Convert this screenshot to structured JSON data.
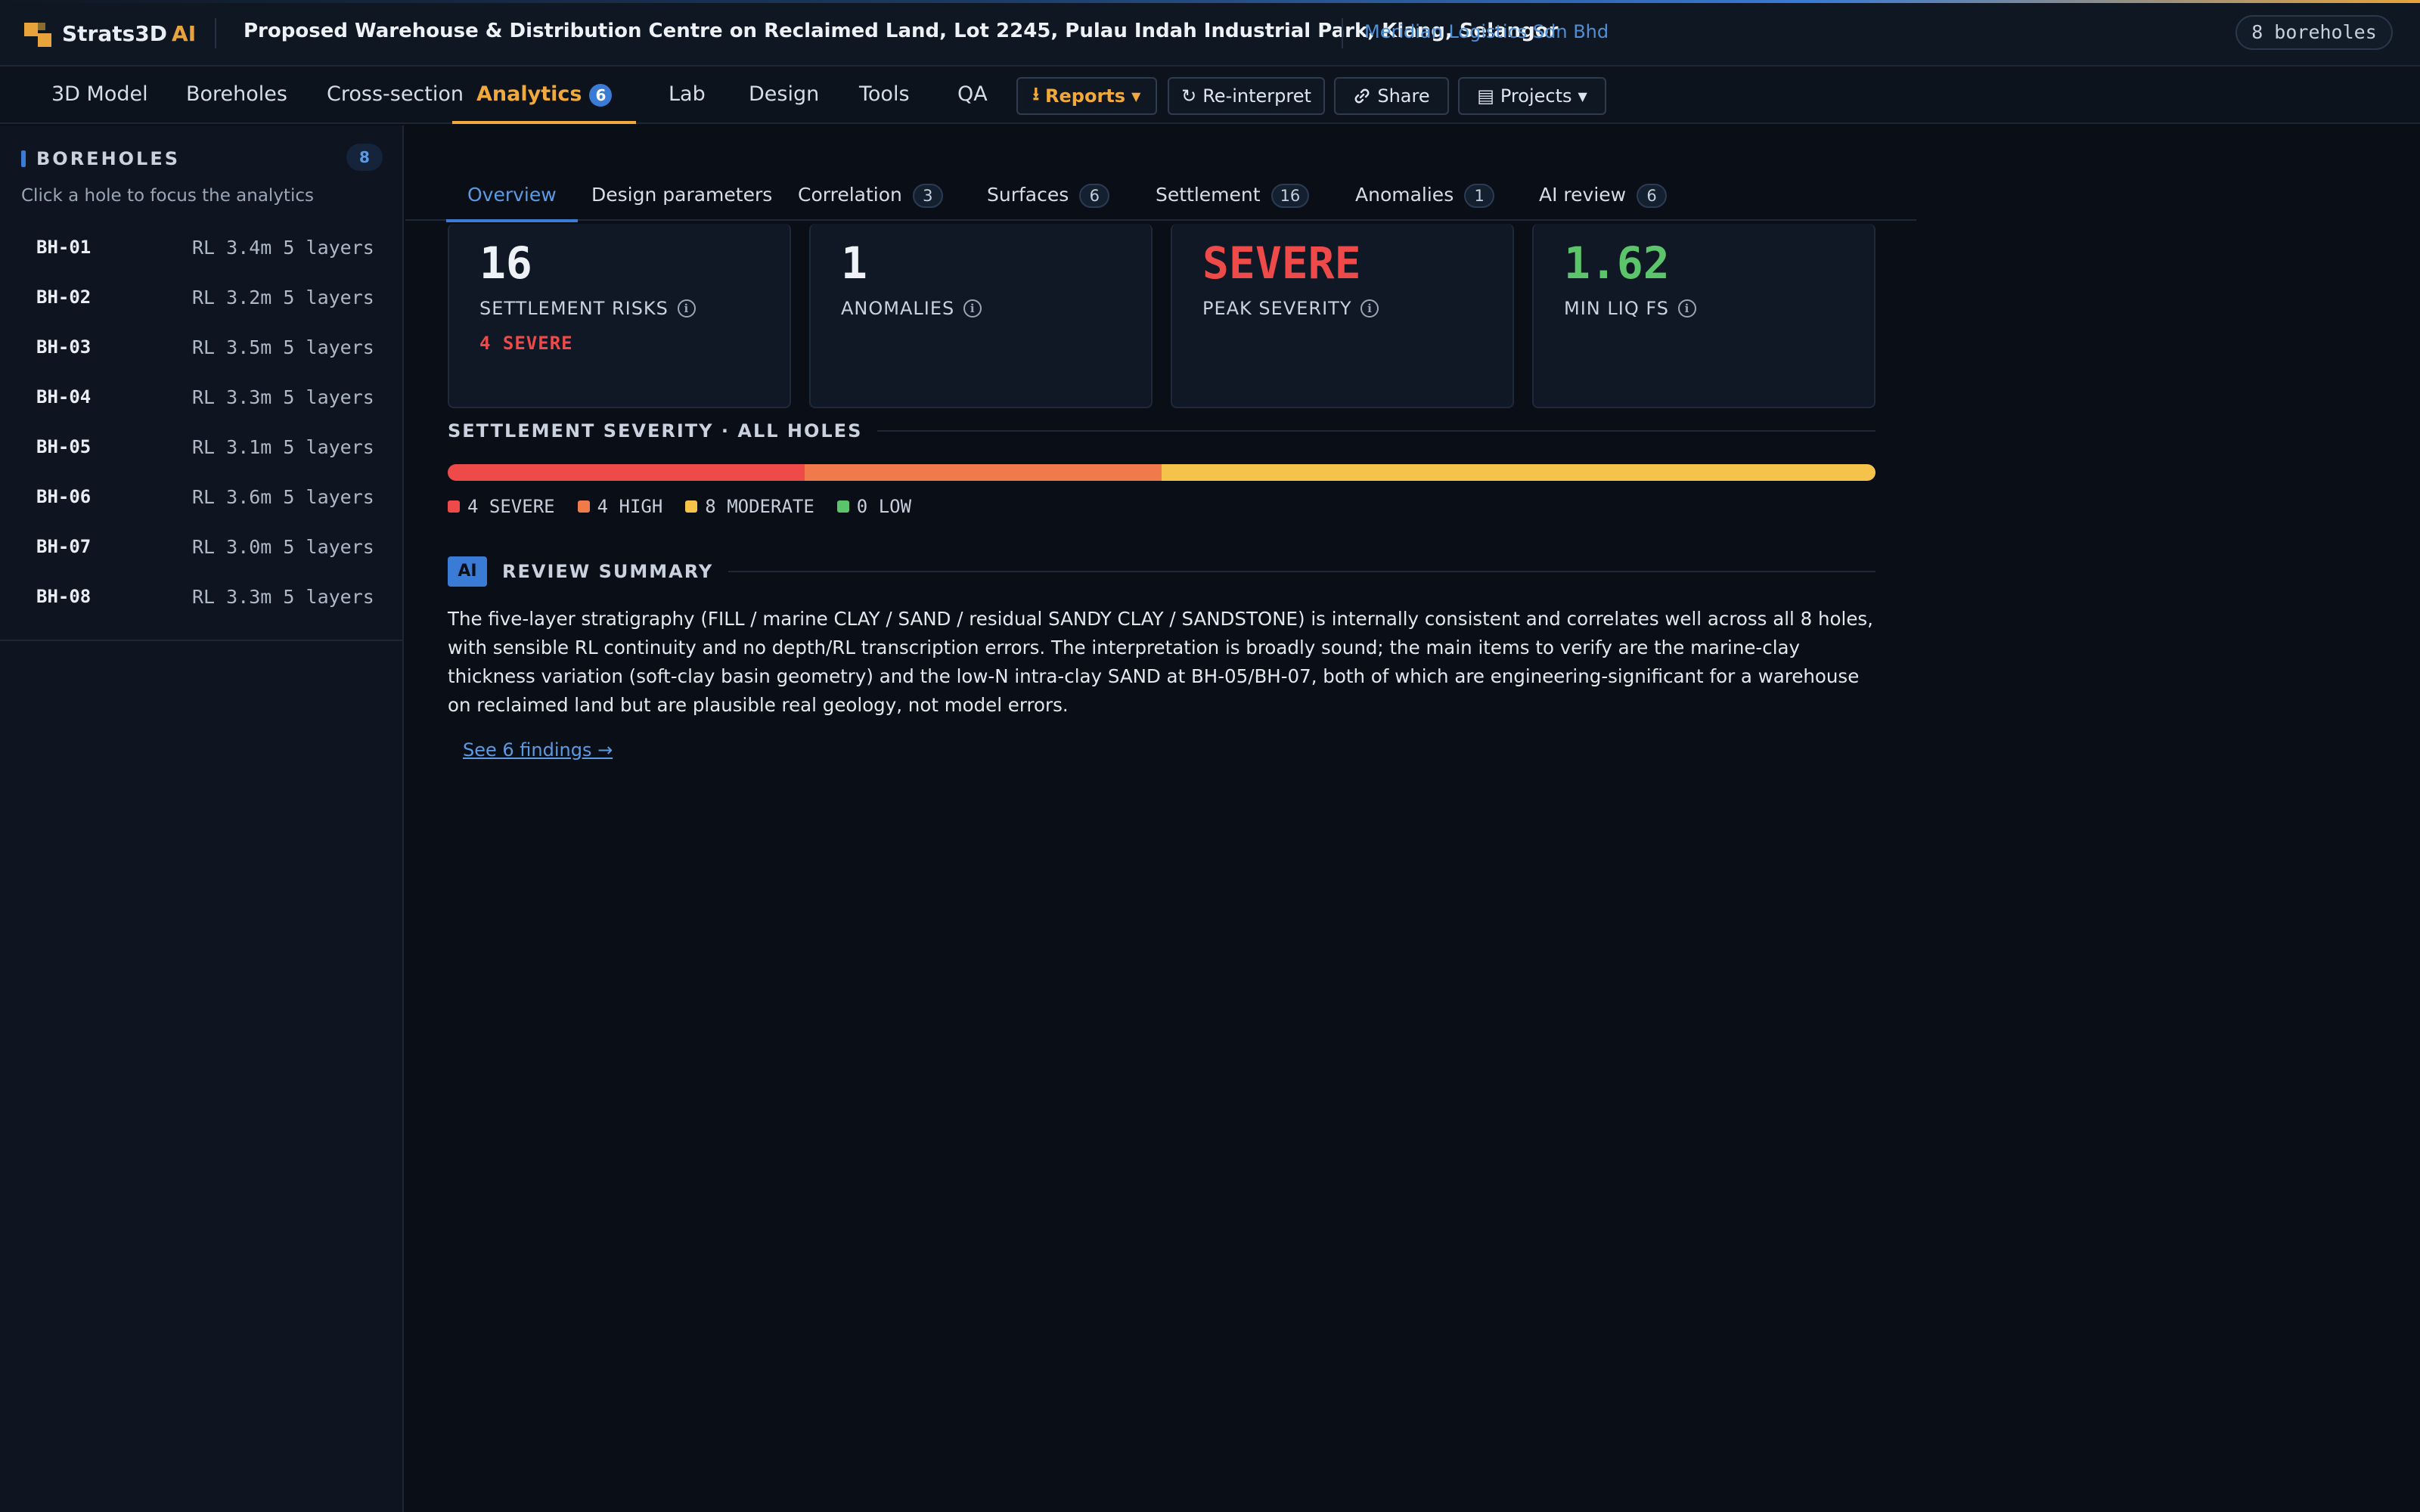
{
  "header": {
    "brand": "Strats3D",
    "brand_suffix": "AI",
    "project_title": "Proposed Warehouse & Distribution Centre on Reclaimed Land, Lot 2245, Pulau Indah Industrial Park, Klang, Selangor",
    "client": "Meridian Logistics Sdn Bhd",
    "borehole_count": "8 boreholes"
  },
  "nav": {
    "items": [
      {
        "label": "3D Model"
      },
      {
        "label": "Boreholes"
      },
      {
        "label": "Cross-section"
      },
      {
        "label": "Analytics",
        "badge": "6"
      },
      {
        "label": "Lab"
      },
      {
        "label": "Design"
      },
      {
        "label": "Tools"
      },
      {
        "label": "QA"
      }
    ],
    "buttons": {
      "reports": "Reports",
      "reinterpret": "Re-interpret",
      "share": "Share",
      "projects": "Projects"
    }
  },
  "sidebar": {
    "title": "BOREHOLES",
    "count": "8",
    "hint": "Click a hole to focus the analytics",
    "boreholes": [
      {
        "id": "BH-01",
        "meta": "RL 3.4m 5 layers"
      },
      {
        "id": "BH-02",
        "meta": "RL 3.2m 5 layers"
      },
      {
        "id": "BH-03",
        "meta": "RL 3.5m 5 layers"
      },
      {
        "id": "BH-04",
        "meta": "RL 3.3m 5 layers"
      },
      {
        "id": "BH-05",
        "meta": "RL 3.1m 5 layers"
      },
      {
        "id": "BH-06",
        "meta": "RL 3.6m 5 layers"
      },
      {
        "id": "BH-07",
        "meta": "RL 3.0m 5 layers"
      },
      {
        "id": "BH-08",
        "meta": "RL 3.3m 5 layers"
      }
    ]
  },
  "subtabs": [
    {
      "label": "Overview",
      "badge": ""
    },
    {
      "label": "Design parameters",
      "badge": ""
    },
    {
      "label": "Correlation",
      "badge": "3"
    },
    {
      "label": "Surfaces",
      "badge": "6"
    },
    {
      "label": "Settlement",
      "badge": "16"
    },
    {
      "label": "Anomalies",
      "badge": "1"
    },
    {
      "label": "AI review",
      "badge": "6"
    }
  ],
  "kpis": [
    {
      "value": "16",
      "label": "SETTLEMENT RISKS",
      "sub": "4  SEVERE"
    },
    {
      "value": "1",
      "label": "ANOMALIES"
    },
    {
      "value": "SEVERE",
      "label": "PEAK SEVERITY"
    },
    {
      "value": "1.62",
      "label": "MIN LIQ FS"
    }
  ],
  "severity": {
    "title": "SETTLEMENT SEVERITY · ALL HOLES",
    "segments": [
      {
        "label": "4 SEVERE",
        "count": 4,
        "color": "#ef4a4a"
      },
      {
        "label": "4 HIGH",
        "count": 4,
        "color": "#f07a4a"
      },
      {
        "label": "8 MODERATE",
        "count": 8,
        "color": "#f5c24a"
      },
      {
        "label": "0 LOW",
        "count": 0,
        "color": "#5cc46a"
      }
    ]
  },
  "review": {
    "chip": "AI",
    "title": "REVIEW SUMMARY",
    "text": "The five-layer stratigraphy (FILL / marine CLAY / SAND / residual SANDY CLAY / SANDSTONE) is internally consistent and correlates well across all 8 holes, with sensible RL continuity and no depth/RL transcription errors. The interpretation is broadly sound; the main items to verify are the marine-clay thickness variation (soft-clay basin geometry) and the low-N intra-clay SAND at BH-05/BH-07, both of which are engineering-significant for a warehouse on reclaimed land but are plausible real geology, not model errors.",
    "link": "See 6 findings →"
  },
  "colors": {
    "accent": "#f0a93a",
    "link": "#5b9be4",
    "danger": "#ef4a4a",
    "success": "#5cc46a"
  }
}
